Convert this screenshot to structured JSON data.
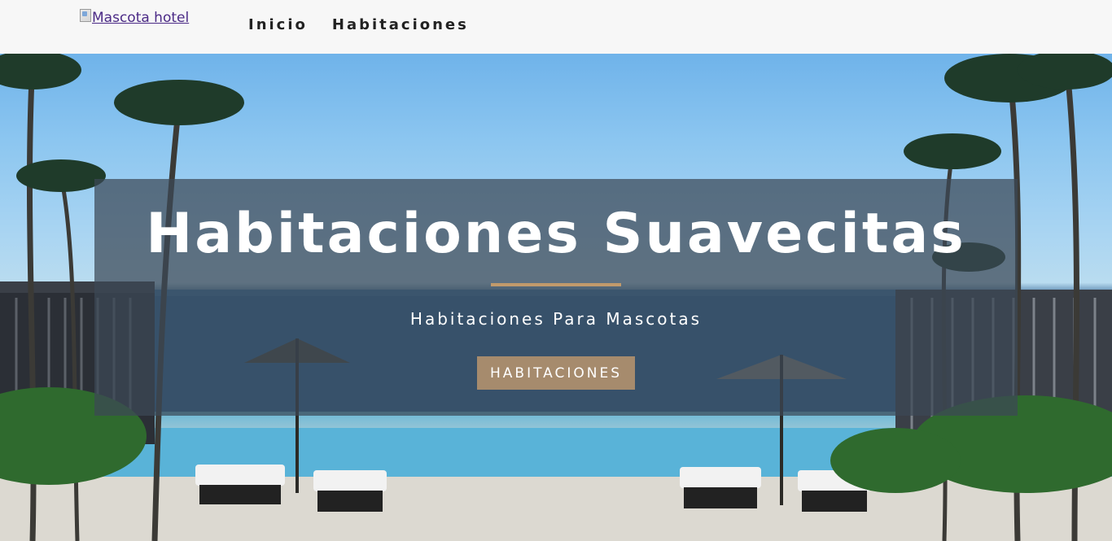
{
  "navbar": {
    "logo_alt": "Mascota hotel",
    "links": [
      {
        "label": "Inicio"
      },
      {
        "label": "Habitaciones"
      }
    ]
  },
  "hero": {
    "title": "Habitaciones Suavecitas",
    "subtitle": "Habitaciones Para Mascotas",
    "button_label": "HABITACIONES"
  },
  "colors": {
    "accent": "#c29a6b",
    "button": "#a68b6d",
    "overlay": "#3c4856",
    "link": "#4b2a86"
  }
}
